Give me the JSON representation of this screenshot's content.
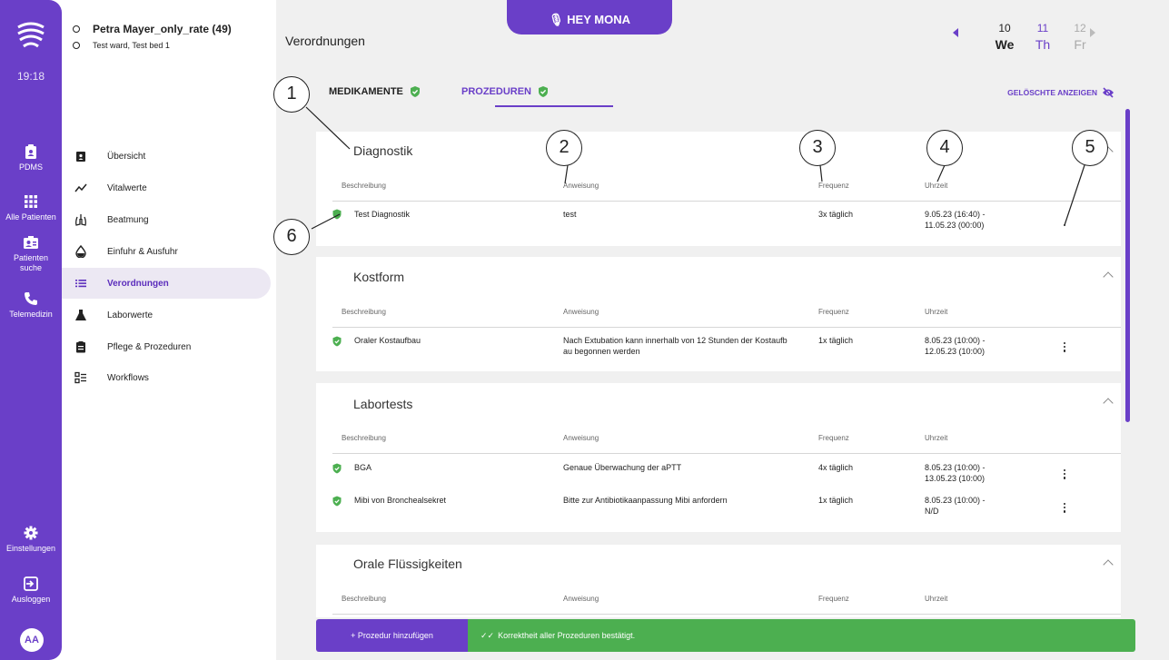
{
  "rail": {
    "time": "19:18",
    "items": [
      {
        "label": "PDMS",
        "icon": "clipboard-person-icon"
      },
      {
        "label": "Alle Patienten",
        "icon": "grid-icon"
      },
      {
        "label": "Patienten suche",
        "icon": "person-search-icon"
      },
      {
        "label": "Telemedizin",
        "icon": "phone-icon"
      }
    ],
    "settings_label": "Einstellungen",
    "logout_label": "Ausloggen",
    "avatar": "AA"
  },
  "patient": {
    "name": "Petra Mayer_only_rate (49)",
    "bed": "Test ward, Test bed 1"
  },
  "nav": [
    {
      "label": "Übersicht",
      "icon": "clipboard-person-icon"
    },
    {
      "label": "Vitalwerte",
      "icon": "trend-line-icon"
    },
    {
      "label": "Beatmung",
      "icon": "lungs-icon"
    },
    {
      "label": "Einfuhr & Ausfuhr",
      "icon": "drop-icon"
    },
    {
      "label": "Verordnungen",
      "icon": "list-icon"
    },
    {
      "label": "Laborwerte",
      "icon": "flask-icon"
    },
    {
      "label": "Pflege & Prozeduren",
      "icon": "clipboard-icon"
    },
    {
      "label": "Workflows",
      "icon": "checklist-icon"
    }
  ],
  "main": {
    "title": "Verordnungen",
    "hey_mona": "HEY MONA",
    "days": [
      {
        "num": "10",
        "wd": "We"
      },
      {
        "num": "11",
        "wd": "Th"
      },
      {
        "num": "12",
        "wd": "Fr"
      }
    ],
    "tabs": [
      "MEDIKAMENTE",
      "PROZEDUREN"
    ],
    "show_deleted": "GELÖSCHTE ANZEIGEN",
    "columns": [
      "Beschreibung",
      "Anweisung",
      "Frequenz",
      "Uhrzeit"
    ],
    "sections": [
      {
        "title": "Diagnostik",
        "rows": [
          {
            "desc": "Test Diagnostik",
            "instr": "test",
            "freq": "3x täglich",
            "time": "9.05.23 (16:40) -\n11.05.23 (00:00)"
          }
        ]
      },
      {
        "title": "Kostform",
        "rows": [
          {
            "desc": "Oraler Kostaufbau",
            "instr": "Nach Extubation kann innerhalb von 12 Stunden der Kostaufb\nau begonnen werden",
            "freq": "1x täglich",
            "time": "8.05.23 (10:00) -\n12.05.23 (10:00)"
          }
        ]
      },
      {
        "title": "Labortests",
        "rows": [
          {
            "desc": "BGA",
            "instr": "Genaue Überwachung der aPTT",
            "freq": "4x täglich",
            "time": "8.05.23 (10:00) -\n13.05.23 (10:00)"
          },
          {
            "desc": "Mibi von Bronchealsekret",
            "instr": "Bitte zur Antibiotikaanpassung Mibi anfordern",
            "freq": "1x täglich",
            "time": "8.05.23 (10:00) -\nN/D"
          }
        ]
      },
      {
        "title": "Orale Flüssigkeiten",
        "rows": []
      }
    ],
    "add_button": "+ Prozedur hinzufügen",
    "confirm_text": "Korrektheit aller Prozeduren bestätigt."
  },
  "callouts": [
    "1",
    "2",
    "3",
    "4",
    "5",
    "6"
  ],
  "colors": {
    "accent": "#6a3fc8",
    "success": "#4caf50"
  }
}
